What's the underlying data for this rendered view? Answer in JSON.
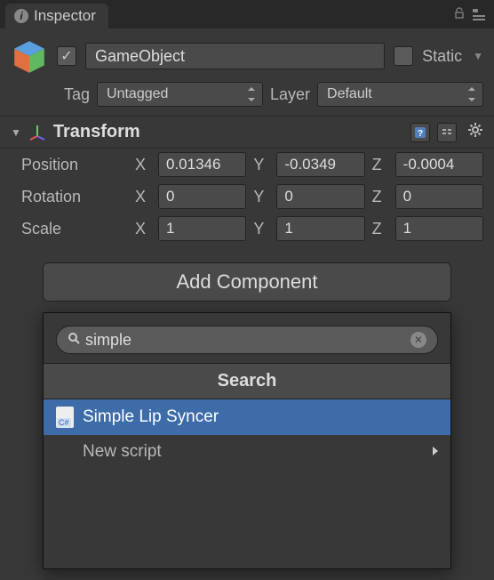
{
  "tab": {
    "label": "Inspector"
  },
  "header": {
    "enabled": true,
    "name": "GameObject",
    "static_label": "Static",
    "is_static": false
  },
  "tag_layer": {
    "tag_label": "Tag",
    "tag_value": "Untagged",
    "layer_label": "Layer",
    "layer_value": "Default"
  },
  "transform": {
    "title": "Transform",
    "rows": {
      "position": {
        "label": "Position",
        "x": "0.01346",
        "y": "-0.0349",
        "z": "-0.0004"
      },
      "rotation": {
        "label": "Rotation",
        "x": "0",
        "y": "0",
        "z": "0"
      },
      "scale": {
        "label": "Scale",
        "x": "1",
        "y": "1",
        "z": "1"
      }
    },
    "axis": {
      "x": "X",
      "y": "Y",
      "z": "Z"
    }
  },
  "add_component": {
    "label": "Add Component"
  },
  "search_popup": {
    "query": "simple",
    "title": "Search",
    "results": [
      {
        "label": "Simple Lip Syncer",
        "type": "script",
        "selected": true
      },
      {
        "label": "New script",
        "type": "submenu",
        "selected": false
      }
    ]
  }
}
